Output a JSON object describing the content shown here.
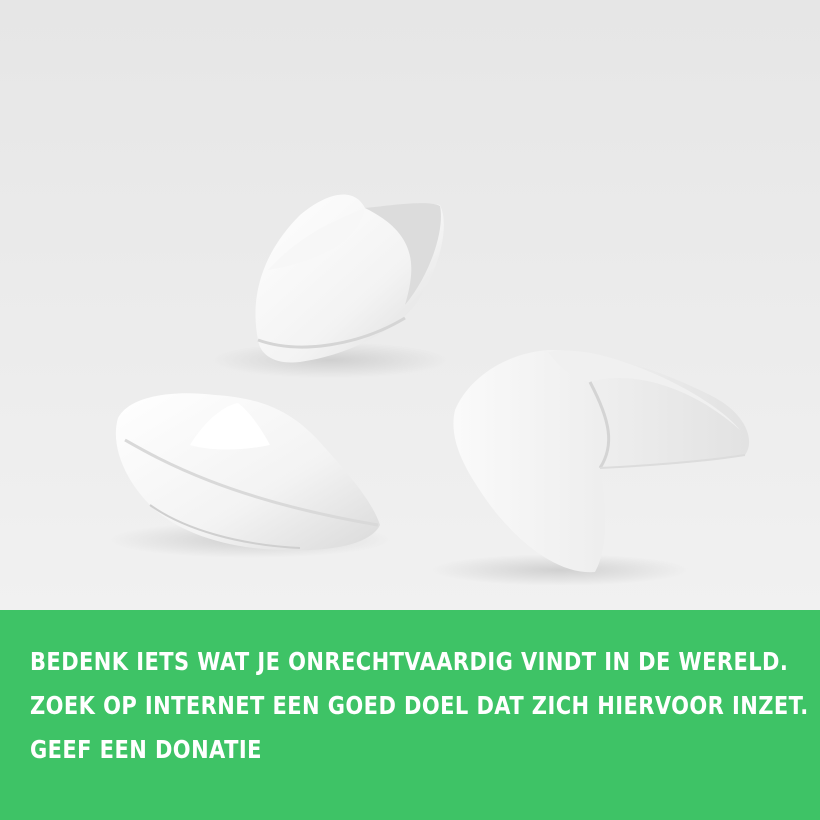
{
  "photo": {
    "subject": "fortune-cookie-sculptures",
    "background_color": "#ededed"
  },
  "caption": {
    "background_color": "#3ec366",
    "text_color": "#ffffff",
    "lines": [
      "BEDENK IETS WAT JE ONRECHTVAARDIG VINDT IN DE WERELD.",
      "ZOEK OP INTERNET EEN GOED DOEL DAT ZICH HIERVOOR INZET.",
      "GEEF EEN DONATIE"
    ]
  }
}
